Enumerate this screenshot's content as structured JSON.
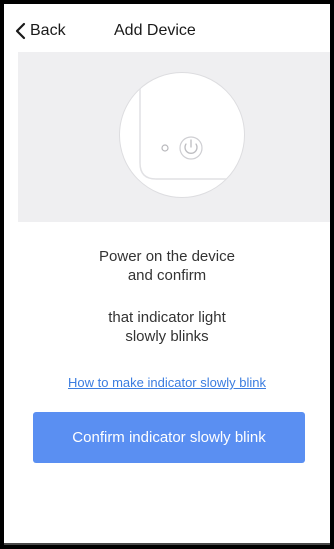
{
  "header": {
    "back_label": "Back",
    "title": "Add Device"
  },
  "illustration": {
    "icon": "power-icon",
    "indicator": "indicator-light-icon"
  },
  "instructions": {
    "line1": "Power on the device\nand confirm",
    "line2": "that indicator light\nslowly blinks"
  },
  "help_link": "How to make indicator slowly blink",
  "confirm_button": "Confirm indicator slowly blink",
  "colors": {
    "accent": "#5a8ff2",
    "link": "#3b7de0",
    "illustration_bg": "#efeff1"
  }
}
